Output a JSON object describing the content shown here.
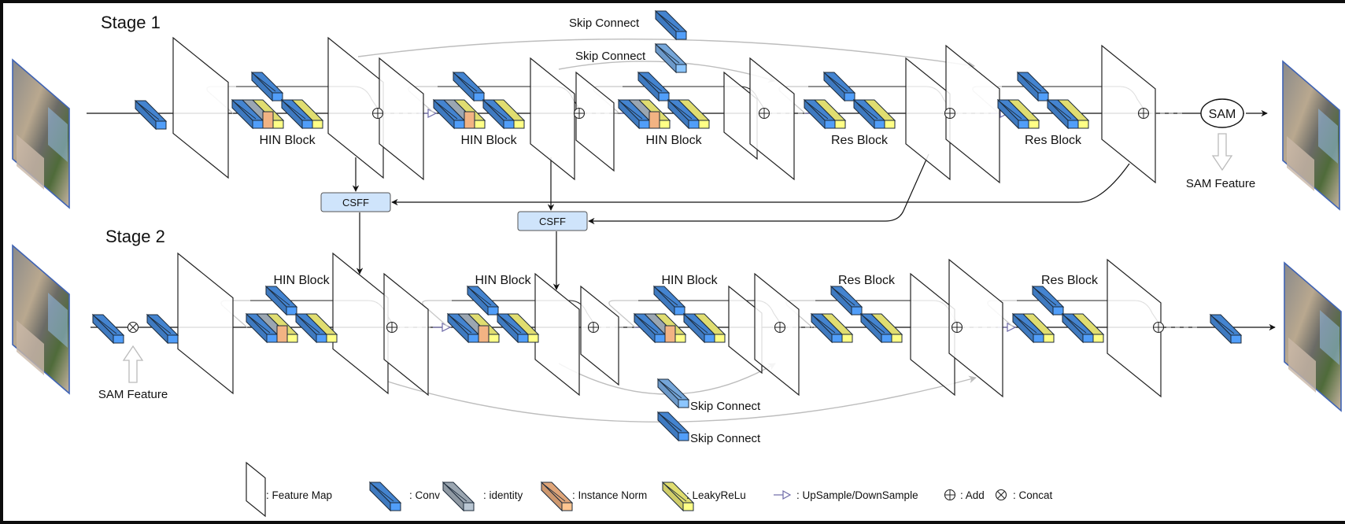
{
  "colors": {
    "conv": "#4a90e2",
    "conv_light": "#7fb4ec",
    "identity": "#a8b4c0",
    "instance_norm": "#f2b383",
    "leaky_relu": "#f3f07a",
    "csff_fill": "#cfe4fb",
    "skip_line": "#bdbdbd",
    "sample_arrow": "#6e6aa8",
    "image_border": "#3f63b4"
  },
  "stages": [
    {
      "title": "Stage 1",
      "blocks": [
        {
          "label": "HIN Block",
          "type": "hin"
        },
        {
          "label": "HIN Block",
          "type": "hin"
        },
        {
          "label": "HIN Block",
          "type": "hin"
        },
        {
          "label": "Res Block",
          "type": "res"
        },
        {
          "label": "Res Block",
          "type": "res"
        }
      ],
      "skip_connects": [
        "Skip Connect",
        "Skip Connect"
      ],
      "sam": {
        "label": "SAM",
        "feature_label": "SAM Feature"
      }
    },
    {
      "title": "Stage 2",
      "blocks": [
        {
          "label": "HIN Block",
          "type": "hin"
        },
        {
          "label": "HIN Block",
          "type": "hin"
        },
        {
          "label": "HIN Block",
          "type": "hin"
        },
        {
          "label": "Res Block",
          "type": "res"
        },
        {
          "label": "Res Block",
          "type": "res"
        }
      ],
      "skip_connects": [
        "Skip Connect",
        "Skip Connect"
      ],
      "sam_input_label": "SAM Feature"
    }
  ],
  "csff": [
    "CSFF",
    "CSFF"
  ],
  "legend": [
    {
      "icon": "feature-map-icon",
      "label": ": Feature Map"
    },
    {
      "icon": "conv-icon",
      "label": ": Conv"
    },
    {
      "icon": "identity-icon",
      "label": ": identity"
    },
    {
      "icon": "instance-norm-icon",
      "label": ": Instance Norm"
    },
    {
      "icon": "leaky-relu-icon",
      "label": ": LeakyReLu"
    },
    {
      "icon": "sample-arrow-icon",
      "label": ": UpSample/DownSample"
    },
    {
      "icon": "add-icon",
      "label": ": Add"
    },
    {
      "icon": "concat-icon",
      "label": ": Concat"
    }
  ]
}
